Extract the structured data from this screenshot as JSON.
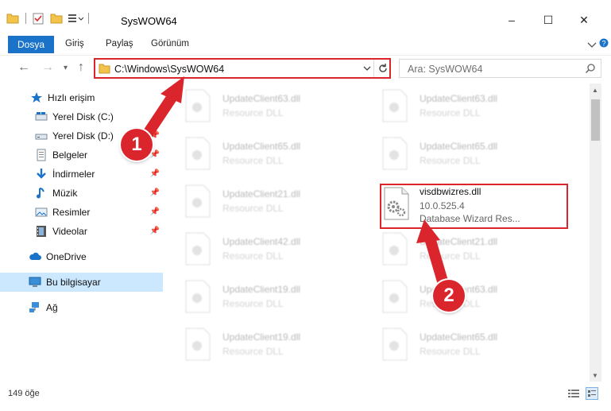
{
  "window": {
    "title": "SysWOW64",
    "controls": {
      "minimize": "–",
      "maximize": "☐",
      "close": "✕"
    }
  },
  "ribbon": {
    "tabs": [
      "Dosya",
      "Giriş",
      "Paylaş",
      "Görünüm"
    ]
  },
  "address": {
    "path": "C:\\Windows\\SysWOW64",
    "search_placeholder": "Ara: SysWOW64"
  },
  "sidebar": {
    "items": [
      {
        "label": "Hızlı erişim",
        "icon": "star-icon"
      },
      {
        "label": "Yerel Disk (C:)",
        "icon": "drive-icon"
      },
      {
        "label": "Yerel Disk (D:)",
        "icon": "drive-icon"
      },
      {
        "label": "Belgeler",
        "icon": "documents-icon"
      },
      {
        "label": "İndirmeler",
        "icon": "download-icon"
      },
      {
        "label": "Müzik",
        "icon": "music-icon"
      },
      {
        "label": "Resimler",
        "icon": "pictures-icon"
      },
      {
        "label": "Videolar",
        "icon": "video-icon"
      },
      {
        "label": "OneDrive",
        "icon": "cloud-icon"
      },
      {
        "label": "Bu bilgisayar",
        "icon": "computer-icon"
      },
      {
        "label": "Ağ",
        "icon": "network-icon"
      }
    ]
  },
  "files": {
    "left": [
      {
        "name": "UpdateClient63.dll",
        "desc": "Resource DLL"
      },
      {
        "name": "UpdateClient65.dll",
        "desc": "Resource DLL"
      },
      {
        "name": "UpdateClient21.dll",
        "desc": "Resource DLL"
      },
      {
        "name": "UpdateClient42.dll",
        "desc": "Resource DLL"
      },
      {
        "name": "UpdateClient19.dll",
        "desc": "Resource DLL"
      },
      {
        "name": "UpdateClient19.dll",
        "desc": "Resource DLL"
      }
    ],
    "right": [
      {
        "name": "UpdateClient63.dll",
        "desc": "Resource DLL"
      },
      {
        "name": "UpdateClient65.dll",
        "desc": "Resource DLL"
      },
      {
        "name": "visdbwizres.dll",
        "version": "10.0.525.4",
        "desc": "Database Wizard Res..."
      },
      {
        "name": "UpdateClient21.dll",
        "desc": "Resource DLL"
      },
      {
        "name": "UpdateClient63.dll",
        "desc": "Resource DLL"
      },
      {
        "name": "UpdateClient65.dll",
        "desc": "Resource DLL"
      }
    ]
  },
  "status": {
    "count": "149 öğe"
  },
  "annotations": {
    "step1": "1",
    "step2": "2",
    "color": "#d9252b"
  }
}
